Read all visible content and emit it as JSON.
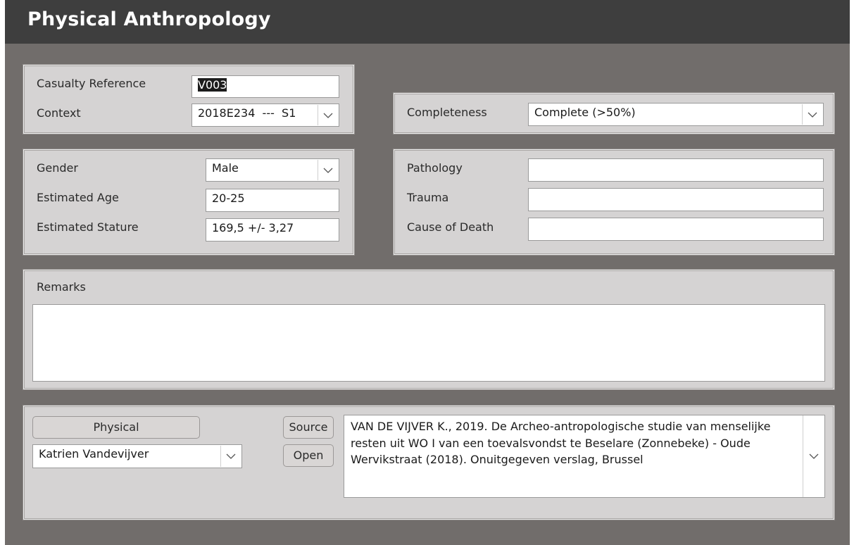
{
  "window": {
    "title": "Physical Anthropology"
  },
  "casualty": {
    "reference_label": "Casualty Reference",
    "reference_value": "V003",
    "context_label": "Context",
    "context_value": "2018E234  ---  S1"
  },
  "completeness": {
    "label": "Completeness",
    "value": "Complete (>50%)"
  },
  "biology": {
    "gender_label": "Gender",
    "gender_value": "Male",
    "age_label": "Estimated Age",
    "age_value": "20-25",
    "stature_label": "Estimated Stature",
    "stature_value": "169,5 +/- 3,27"
  },
  "condition": {
    "pathology_label": "Pathology",
    "pathology_value": "",
    "trauma_label": "Trauma",
    "trauma_value": "",
    "cause_label": "Cause of Death",
    "cause_value": ""
  },
  "remarks": {
    "label": "Remarks",
    "value": ""
  },
  "source_panel": {
    "physical_button": "Physical",
    "person_value": "Katrien Vandevijver",
    "source_button": "Source",
    "open_button": "Open",
    "source_text": "VAN DE VIJVER K., 2019. De Archeo-antropologische studie van menselijke resten uit WO I van een toevalsvondst te Beselare (Zonnebeke) - Oude Wervikstraat (2018). Onuitgegeven verslag, Brussel"
  },
  "icons": {
    "dropdown": "chevron-down-icon"
  }
}
